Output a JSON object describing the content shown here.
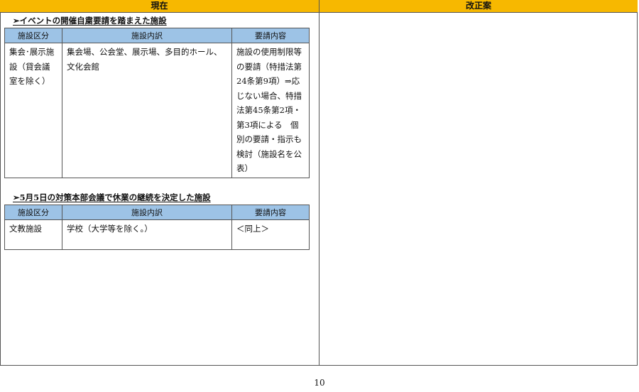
{
  "columns": {
    "current": "現在",
    "revision": "改正案"
  },
  "section1": {
    "title": "➢イベントの開催自粛要請を踏まえた施設",
    "headers": [
      "施設区分",
      "施設内訳",
      "要請内容"
    ],
    "row": {
      "category": "集会･展示施設（貸会議室を除く）",
      "breakdown": "集会場、公会堂、展示場、多目的ホール、文化会館",
      "request": "施設の使用制限等の要請（特措法第24条第9項）⇒応じない場合、特措法第45条第2項・第3項による　個別の要請・指示も検討（施設名を公表）"
    }
  },
  "section2": {
    "title": "➢5月5日の対策本部会議で休業の継続を決定した施設",
    "headers": [
      "施設区分",
      "施設内訳",
      "要請内容"
    ],
    "row": {
      "category": "文教施設",
      "breakdown": "学校（大学等を除く。）",
      "request": "＜同上＞"
    }
  },
  "page_number": "10"
}
